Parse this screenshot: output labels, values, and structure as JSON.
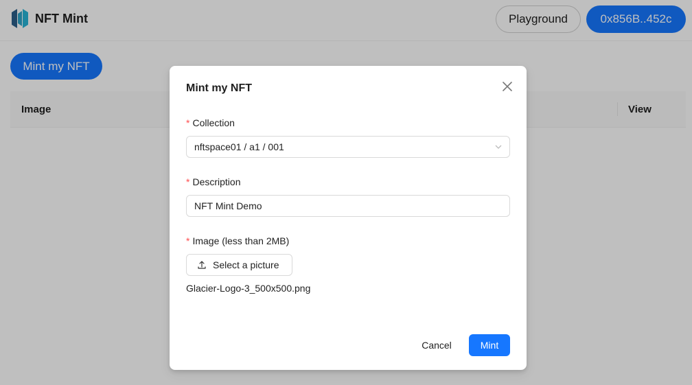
{
  "header": {
    "app_title": "NFT Mint",
    "playground_label": "Playground",
    "wallet_label": "0x856B..452c"
  },
  "page": {
    "mint_button_label": "Mint my NFT",
    "table": {
      "columns": [
        "Image",
        "View"
      ]
    }
  },
  "modal": {
    "title": "Mint my NFT",
    "collection": {
      "label": "Collection",
      "value": "nftspace01 / a1 / 001"
    },
    "description": {
      "label": "Description",
      "value": "NFT Mint Demo"
    },
    "image": {
      "label": "Image (less than 2MB)",
      "upload_label": "Select a picture",
      "file_name": "Glacier-Logo-3_500x500.png"
    },
    "cancel_label": "Cancel",
    "mint_label": "Mint"
  },
  "colors": {
    "primary": "#1677ff",
    "required": "#ff4d4f",
    "overlay": "rgba(0,0,0,0.25)"
  },
  "icons": {
    "logo": "nft-mint-logo-icon",
    "close": "close-icon",
    "dropdown": "chevron-down-icon",
    "upload": "upload-icon"
  }
}
